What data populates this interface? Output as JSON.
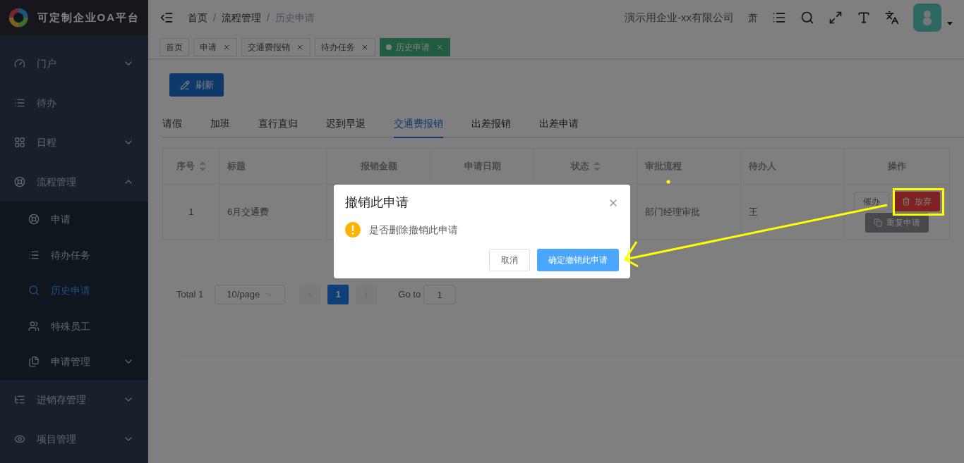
{
  "app": {
    "title": "可定制企业OA平台"
  },
  "sidebar": {
    "items": [
      {
        "label": "门户",
        "selected": false,
        "expanded": false
      },
      {
        "label": "待办",
        "selected": false
      },
      {
        "label": "日程",
        "selected": false,
        "expanded": false
      },
      {
        "label": "流程管理",
        "selected": false,
        "expanded": true,
        "children": [
          {
            "label": "申请",
            "selected": false
          },
          {
            "label": "待办任务",
            "selected": false
          },
          {
            "label": "历史申请",
            "selected": true
          },
          {
            "label": "特殊员工",
            "selected": false
          },
          {
            "label": "申请管理",
            "selected": false,
            "expanded": false
          }
        ]
      },
      {
        "label": "进销存管理",
        "selected": false,
        "expanded": false
      },
      {
        "label": "项目管理",
        "selected": false,
        "expanded": false
      }
    ]
  },
  "header": {
    "breadcrumb": [
      "首页",
      "流程管理",
      "历史申请"
    ],
    "breadcrumb_separator": "/",
    "company": "演示用企业-xx有限公司",
    "language": "萧"
  },
  "view_tags": [
    {
      "label": "首页",
      "closable": false,
      "selected": false
    },
    {
      "label": "申请",
      "closable": true,
      "selected": false
    },
    {
      "label": "交通费报销",
      "closable": true,
      "selected": false
    },
    {
      "label": "待办任务",
      "closable": true,
      "selected": false
    },
    {
      "label": "历史申请",
      "closable": true,
      "selected": true
    }
  ],
  "refresh_button": "刷新",
  "tabs": [
    {
      "label": "请假",
      "selected": false
    },
    {
      "label": "加班",
      "selected": false
    },
    {
      "label": "直行直归",
      "selected": false
    },
    {
      "label": "迟到早退",
      "selected": false
    },
    {
      "label": "交通费报销",
      "selected": true
    },
    {
      "label": "出差报销",
      "selected": false
    },
    {
      "label": "出差申请",
      "selected": false
    }
  ],
  "table": {
    "columns": [
      {
        "label": "序号",
        "sortable": true
      },
      {
        "label": "标题",
        "sortable": false
      },
      {
        "label": "报销金额",
        "sortable": false
      },
      {
        "label": "申请日期",
        "sortable": false
      },
      {
        "label": "状态",
        "sortable": true
      },
      {
        "label": "审批流程",
        "sortable": false
      },
      {
        "label": "待办人",
        "sortable": false
      },
      {
        "label": "操作",
        "sortable": false
      }
    ],
    "rows": [
      {
        "cells": [
          "1",
          "6月交通费",
          null,
          null,
          null,
          "部门经理审批",
          "王"
        ],
        "actions": [
          {
            "label": "催办",
            "kind": "plain"
          },
          {
            "label": "放弃",
            "kind": "danger"
          },
          {
            "label": "重复申请",
            "kind": "info"
          }
        ]
      }
    ]
  },
  "pagination": {
    "total": "Total 1",
    "page_size": "10/page",
    "pages": [
      {
        "label": "1",
        "selected": true
      }
    ],
    "goto_label": "Go to",
    "goto_value": "1"
  },
  "dialog": {
    "title": "撤销此申请",
    "message": "是否删除撤销此申请",
    "cancel": "取消",
    "confirm": "确定撤销此申请"
  }
}
